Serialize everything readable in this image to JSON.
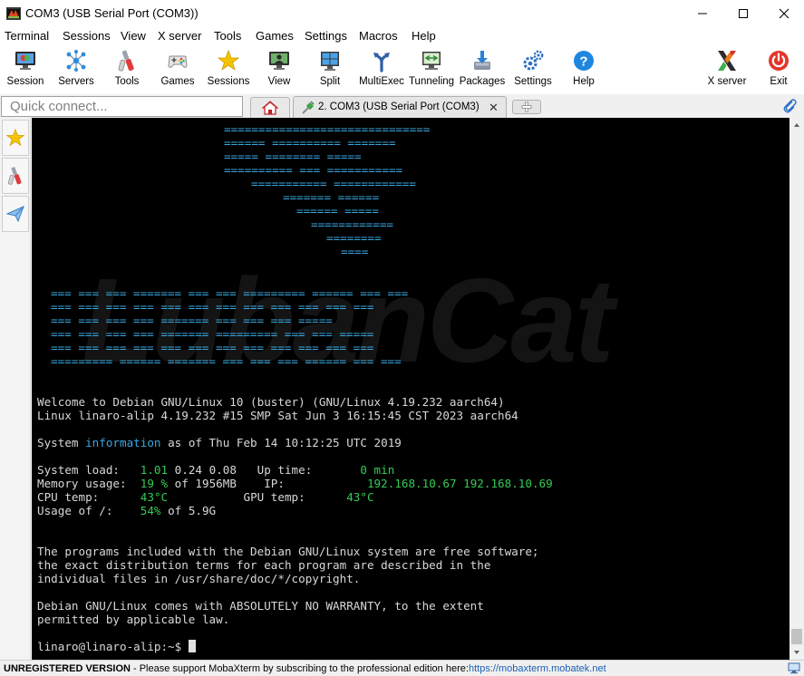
{
  "window": {
    "title": "COM3  (USB Serial Port (COM3))",
    "minimize_symbol": "─",
    "maximize_symbol": "☐",
    "close_symbol": "✕"
  },
  "menu": [
    "Terminal",
    "Sessions",
    "View",
    "X server",
    "Tools",
    "Games",
    "Settings",
    "Macros",
    "Help"
  ],
  "toolbar": {
    "items": [
      {
        "label": "Session",
        "icon": "session-monitor-icon"
      },
      {
        "label": "Servers",
        "icon": "servers-network-icon"
      },
      {
        "label": "Tools",
        "icon": "tools-icon"
      },
      {
        "label": "Games",
        "icon": "gamepad-icon"
      },
      {
        "label": "Sessions",
        "icon": "star-icon"
      },
      {
        "label": "View",
        "icon": "view-monitor-icon"
      },
      {
        "label": "Split",
        "icon": "split-grid-icon"
      },
      {
        "label": "MultiExec",
        "icon": "multiexec-fork-icon"
      },
      {
        "label": "Tunneling",
        "icon": "tunneling-icon"
      },
      {
        "label": "Packages",
        "icon": "packages-download-icon"
      },
      {
        "label": "Settings",
        "icon": "gears-icon"
      },
      {
        "label": "Help",
        "icon": "help-question-icon"
      }
    ],
    "xserver_label": "X server",
    "exit_label": "Exit"
  },
  "tabs": {
    "quick_connect_placeholder": "Quick connect...",
    "active_tab_label": "2. COM3  (USB Serial Port (COM3))",
    "active_tab_close": "✕"
  },
  "terminal": {
    "banner": {
      "ascii_rows": [
        "==============================",
        "======      ==========      =======",
        "=====       ========       =====",
        "==========    ===    ===========",
        "===========    ============",
        "=======       ======",
        "======     =====",
        "============",
        "========",
        "===="
      ],
      "logo_rows": [
        "===         ===    ===      =======    ===    ===  =========      ======    ===         ===",
        "===         ===    ===   ===     ===   ===   ===   ===         ===    ===    ===  ===",
        "===         ===    ===  ===            =======     ===        ===       ===    =====",
        "===         ===    ===  ===            =======     =========  ===       ===    =====",
        "===         ===    ===   ===     ===   ===   ===   ===         ===    ===    ===  ===",
        "=========    ======       =======      ===    ===  ===           ======    ===         ==="
      ],
      "watermark": "LubanCat"
    },
    "lines": {
      "welcome": "Welcome to Debian GNU/Linux 10 (buster) (GNU/Linux 4.19.232 aarch64)",
      "kernel": "Linux linaro-alip 4.19.232 #15 SMP Sat Jun 3 16:15:45 CST 2023 aarch64",
      "sysinfo_pre": "System ",
      "sysinfo_word": "information",
      "sysinfo_post": " as of Thu Feb 14 10:12:25 UTC 2019",
      "load_label": "System load:   ",
      "load_v1": "1.01",
      "load_rest": " 0.24 0.08   Up time:       ",
      "uptime": "0 min",
      "mem_label": "Memory usage:  ",
      "mem_pct": "19 %",
      "mem_rest": " of 1956MB    IP:            ",
      "ip": "192.168.10.67 192.168.10.69",
      "cpu_label": "CPU temp:      ",
      "cpu_temp": "43°C",
      "gpu_label": "           GPU temp:      ",
      "gpu_temp": "43°C",
      "usage_label": "Usage of /:    ",
      "usage_pct": "54%",
      "usage_rest": " of 5.9G",
      "lic1": "The programs included with the Debian GNU/Linux system are free software;",
      "lic2": "the exact distribution terms for each program are described in the",
      "lic3": "individual files in /usr/share/doc/*/copyright.",
      "war1": "Debian GNU/Linux comes with ABSOLUTELY NO WARRANTY, to the extent",
      "war2": "permitted by applicable law.",
      "prompt": "linaro@linaro-alip:~$ "
    }
  },
  "status": {
    "bold": "UNREGISTERED VERSION",
    "message": " -  Please support MobaXterm by subscribing to the professional edition here:",
    "link": "https://mobaxterm.mobatek.net"
  },
  "colors": {
    "terminal_bg": "#000000",
    "terminal_fg": "#d8d8d8",
    "blue": "#3aa7e0",
    "green": "#33cc55"
  }
}
